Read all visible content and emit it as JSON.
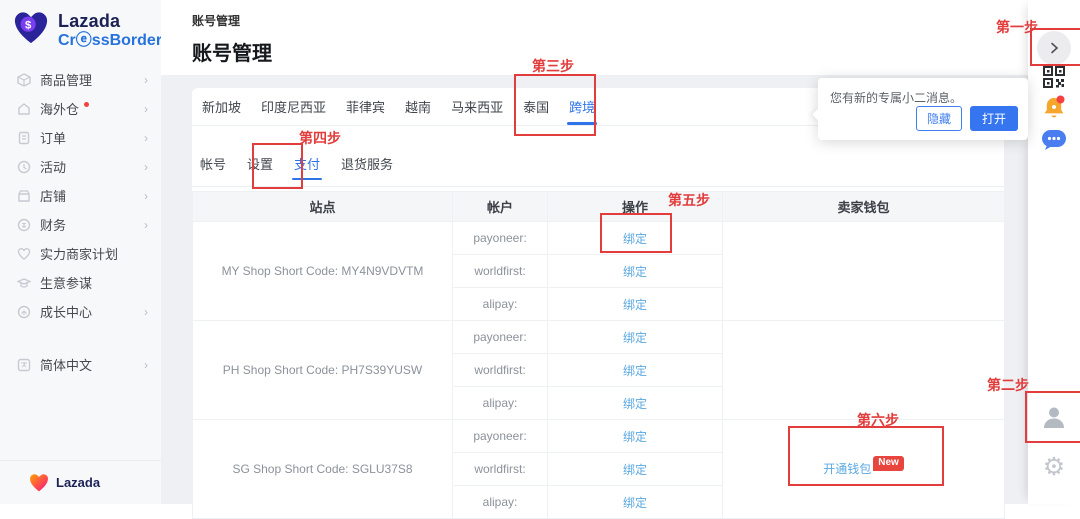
{
  "brand": {
    "line1": "Lazada",
    "line2_pre": "Cr",
    "line2_mid": "ⓔ",
    "line2_post": "ssBorder",
    "footer_name": "Lazada"
  },
  "sidebar": {
    "items": [
      {
        "label": "商品管理"
      },
      {
        "label": "海外仓"
      },
      {
        "label": "订单"
      },
      {
        "label": "活动"
      },
      {
        "label": "店铺"
      },
      {
        "label": "财务"
      },
      {
        "label": "实力商家计划"
      },
      {
        "label": "生意参谋"
      },
      {
        "label": "成长中心"
      }
    ],
    "language": {
      "label": "简体中文"
    },
    "chevron": "›"
  },
  "header": {
    "breadcrumb": "账号管理",
    "title": "账号管理"
  },
  "tabs": {
    "countries": [
      "新加坡",
      "印度尼西亚",
      "菲律宾",
      "越南",
      "马来西亚",
      "泰国",
      "跨境"
    ],
    "active_country": "跨境",
    "subtabs": [
      "帐号",
      "设置",
      "支付",
      "退货服务"
    ],
    "active_subtab": "支付"
  },
  "table": {
    "headers": [
      "站点",
      "帐户",
      "操作",
      "卖家钱包"
    ],
    "groups": [
      {
        "site": "MY Shop Short Code: MY4N9VDVTM",
        "accounts": [
          "payoneer:",
          "worldfirst:",
          "alipay:"
        ],
        "wallet": ""
      },
      {
        "site": "PH Shop Short Code: PH7S39YUSW",
        "accounts": [
          "payoneer:",
          "worldfirst:",
          "alipay:"
        ],
        "wallet": ""
      },
      {
        "site": "SG Shop Short Code: SGLU37S8",
        "accounts": [
          "payoneer:",
          "worldfirst:",
          "alipay:"
        ],
        "wallet": "开通钱包"
      }
    ],
    "bind_label": "绑定",
    "wallet_badge": "New"
  },
  "popup": {
    "message": "您有新的专属小二消息。",
    "hide_label": "隐藏",
    "open_label": "打开"
  },
  "steps": {
    "one": "第一步",
    "two": "第二步",
    "three": "第三步",
    "four": "第四步",
    "five": "第五步",
    "six": "第六步"
  },
  "colors": {
    "accent_blue": "#2e73e8",
    "link_blue": "#5aa8e2",
    "annotation_red": "#e23c3c",
    "badge_red": "#e8453f",
    "bell_orange": "#f6a62c",
    "sidebar_bg": "#f7f8fa"
  }
}
